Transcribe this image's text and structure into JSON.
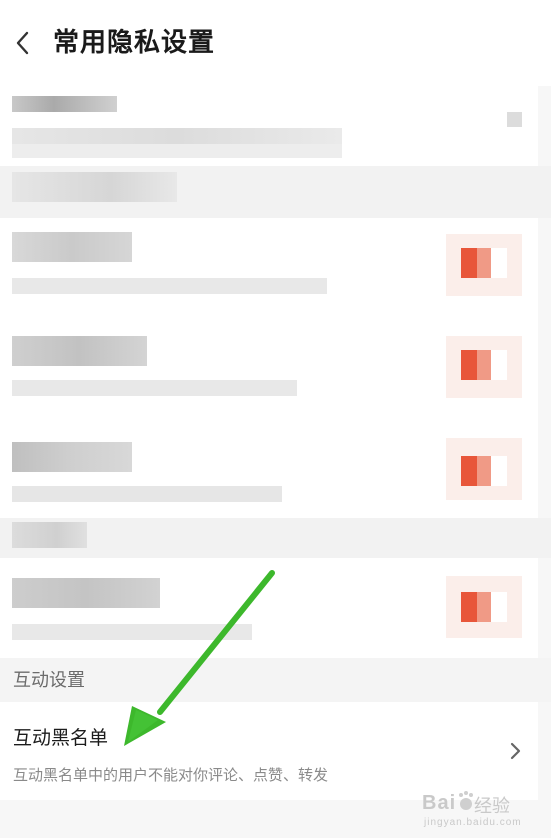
{
  "header": {
    "back_icon": "chevron-left-icon",
    "title": "常用隐私设置"
  },
  "privacy_items": [
    {
      "label": "",
      "description": "",
      "toggle_state": "obscured-on",
      "obscured": true
    },
    {
      "label": "",
      "description": "",
      "toggle_state": "obscured-on",
      "obscured": true
    },
    {
      "label": "",
      "description": "",
      "toggle_state": "obscured-on",
      "obscured": true
    },
    {
      "label": "",
      "description": "",
      "toggle_state": "obscured-on",
      "obscured": true
    }
  ],
  "interaction": {
    "section_title": "互动设置",
    "blacklist": {
      "label": "互动黑名单",
      "description": "互动黑名单中的用户不能对你评论、点赞、转发",
      "chevron_icon": "chevron-right-icon"
    }
  },
  "watermark": {
    "brand": "Bai",
    "sub": "经验",
    "url": "jingyan.baidu.com"
  },
  "colors": {
    "accent_toggle": "#e8563a",
    "annotation_arrow": "#3db82c",
    "background": "#f7f7f7"
  }
}
